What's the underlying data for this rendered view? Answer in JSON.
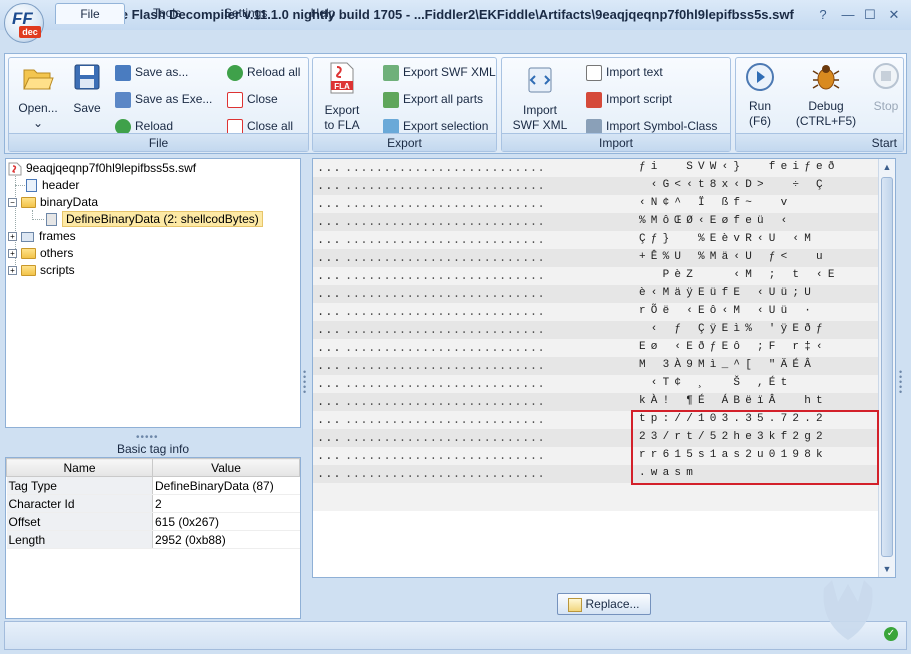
{
  "window": {
    "title": "JPEXS Free Flash Decompiler v.11.1.0 nightly build 1705 - ...Fiddler2\\EKFiddle\\Artifacts\\9eaqjqeqnp7f0hl9lepifbss5s.swf",
    "logo_top": "FF",
    "logo_bottom": "dec",
    "controls": {
      "help": "?",
      "minimize": "—",
      "maximize": "☐",
      "close": "✕"
    }
  },
  "menu": {
    "tabs": [
      {
        "label": "File"
      },
      {
        "label": "Tools"
      },
      {
        "label": "Settings"
      },
      {
        "label": "Help"
      }
    ]
  },
  "ribbon": {
    "file_group": {
      "label": "File",
      "open": "Open...",
      "save": "Save",
      "save_as": "Save as...",
      "save_as_exe": "Save as Exe...",
      "reload": "Reload",
      "reload_all": "Reload all",
      "close": "Close",
      "close_all": "Close all"
    },
    "export_group": {
      "label": "Export",
      "export_fla_line1": "Export",
      "export_fla_line2": "to FLA",
      "fla_icon_text": "FLA",
      "export_swf_xml": "Export SWF XML",
      "export_all_parts": "Export all parts",
      "export_selection": "Export selection"
    },
    "import_group": {
      "label": "Import",
      "import_swf_xml_line1": "Import",
      "import_swf_xml_line2": "SWF XML",
      "import_text": "Import text",
      "import_script": "Import script",
      "import_symbol_class": "Import Symbol-Class"
    },
    "start_group": {
      "label": "Start",
      "run_line1": "Run",
      "run_line2": "(F6)",
      "debug_line1": "Debug",
      "debug_line2": "(CTRL+F5)",
      "stop": "Stop"
    }
  },
  "tree": {
    "root": "9eaqjqeqnp7f0hl9lepifbss5s.swf",
    "header": "header",
    "binaryData": "binaryData",
    "selected": "DefineBinaryData (2: shellcodBytes)",
    "frames": "frames",
    "others": "others",
    "scripts": "scripts"
  },
  "tag_info": {
    "title": "Basic tag info",
    "col_name": "Name",
    "col_value": "Value",
    "rows": [
      {
        "name": "Tag Type",
        "value": "DefineBinaryData (87)"
      },
      {
        "name": "Character Id",
        "value": "2"
      },
      {
        "name": "Offset",
        "value": "615 (0x267)"
      },
      {
        "name": "Length",
        "value": "2952 (0xb88)"
      }
    ]
  },
  "hex": {
    "offset_text": "...",
    "hex_text": "..........................",
    "ascii_rows": [
      "ƒi  SVW‹}  feiƒeð",
      " ‹G<‹t8x‹D>  ÷ Ç",
      "‹N¢^ Ï ßf~  v",
      "%MôŒØ‹Eøfeü ‹",
      "Çƒ}  %EèvR‹U ‹M",
      "+Ê%U %Mä‹U ƒ<  u",
      "  PèZ   ‹M ; t ‹E",
      "è‹MäÿEüfE ‹Uü;U",
      "rÕë ‹Eô‹M ‹Uü ·",
      " ‹ ƒ ÇÿEì% 'ÿEðƒ",
      "Eø ‹EðƒEô ;F r‡‹",
      "M 3À9Mì_^[ \"ÄÉÂ",
      " ‹T¢ ¸  Š ,Ét",
      "kÀ! ¶É ÁBëïÂ  ht",
      "tp://103.35.72.2",
      "23/rt/52he3kf2g2",
      "rr615s1as2u0198k",
      ".wasm"
    ]
  },
  "replace_button": "Replace...",
  "status_ok": "✓"
}
